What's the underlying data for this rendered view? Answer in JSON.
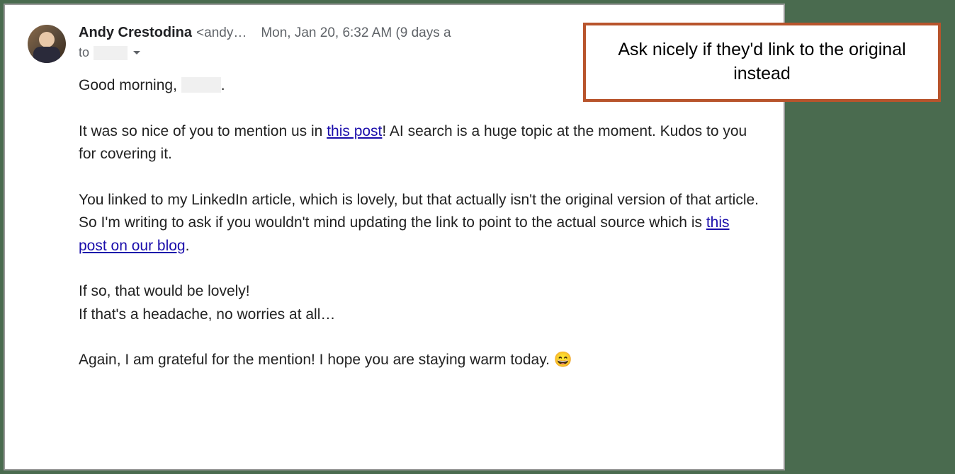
{
  "email": {
    "sender_name": "Andy Crestodina",
    "sender_email": "<andy…",
    "timestamp": "Mon, Jan 20, 6:32 AM (9 days a",
    "to_label": "to",
    "body": {
      "greeting_prefix": "Good morning, ",
      "greeting_suffix": ".",
      "p2_part1": "It was so nice of you to mention us in ",
      "p2_link1": "this post",
      "p2_part2": "! AI search is a huge topic at the moment. Kudos to you for covering it.",
      "p3_part1": "You linked to my LinkedIn article, which is lovely, but that actually isn't the original version of that article. So I'm writing to ask if you wouldn't mind updating the link to point to the actual source which is ",
      "p3_link1": "this post on our blog",
      "p3_part2": ".",
      "p4_line1": "If so, that would be lovely!",
      "p4_line2": "If that's a headache, no worries at all…",
      "p5": "Again, I am grateful for the mention! I hope you are staying warm today. 😄"
    }
  },
  "callout": {
    "text": "Ask nicely if they'd link to the original instead"
  }
}
